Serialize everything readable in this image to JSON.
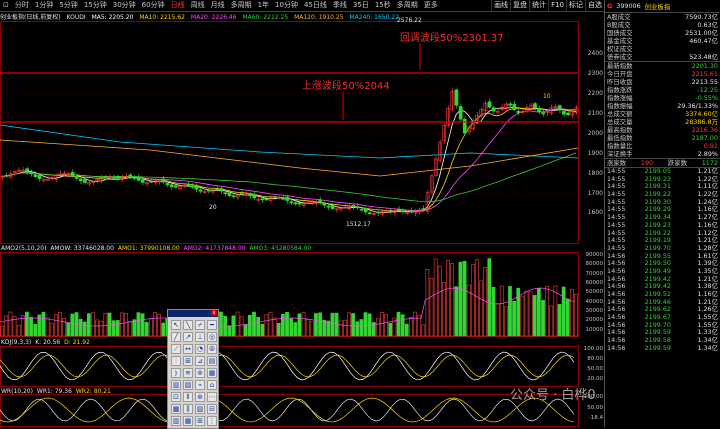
{
  "toolbar": {
    "app_icon": "pin-icon",
    "periods": [
      "分时",
      "1分钟",
      "5分钟",
      "15分钟",
      "30分钟",
      "60分钟",
      "日线",
      "周线",
      "月线",
      "多周期",
      "1年",
      "10分钟",
      "45日线",
      "季线",
      "35日",
      "15秒",
      "多周期",
      "更多"
    ],
    "active_period": "日线",
    "tools": [
      "画线",
      "复盘",
      "统计",
      "F10",
      "标记",
      "自选"
    ]
  },
  "info_line": {
    "title": "创业板指(日线,前复权)",
    "indicator": "KOUDI",
    "ma5": "MA5: 2205.20",
    "ma10": "MA10: 2215.62",
    "ma20": "MA20: 2226.46",
    "ma60": "MA60: 2212.25",
    "ma120": "MA120: 1910.25",
    "ma240": "MA240: 1650.22"
  },
  "price_axis": [
    "2400",
    "2300",
    "2200",
    "2100",
    "2000",
    "1900",
    "1800",
    "1700",
    "1600"
  ],
  "annotations": {
    "high_label": "2576.22",
    "low_label": "1512.17",
    "low_label_left": "20",
    "upper_text": "回调波段50%2301.37",
    "lower_text": "上涨波段50%2044",
    "cursor_marker": "10"
  },
  "colors": {
    "up": "#ff3b3b",
    "down": "#33d633",
    "accent": "#ffd400",
    "line_red": "#e00000"
  },
  "volume": {
    "label": "AMO2(5,10,20)",
    "amow": "AMOW: 33746028.00",
    "amo1": "AMO1: 37990108.00",
    "amo2": "AMO2: 41737848.00",
    "amo3": "AMO3: 45280584.00",
    "axis": [
      "90000",
      "80000",
      "70000",
      "60000",
      "50000",
      "40000",
      "30000",
      "20000",
      "10000"
    ]
  },
  "kdj": {
    "label": "KDJ(9,3,3)",
    "k": "K: 20.56",
    "d": "D: 21.92",
    "axis": [
      "100.00",
      "80.00",
      "50.00",
      "20.00"
    ]
  },
  "wr": {
    "label": "WR(10,20)",
    "wr1": "WR1: 79.36",
    "wr2": "WR2: 80.21",
    "axis": [
      "100.00",
      "50.00",
      "-18.4"
    ]
  },
  "right_panel": {
    "badge": "G",
    "code": "399006",
    "name": "创业板指",
    "stats": [
      {
        "k": "A股成交",
        "v": "7590.73亿",
        "c": "wh"
      },
      {
        "k": "B股成交",
        "v": "0.63亿",
        "c": "wh"
      },
      {
        "k": "国债成交",
        "v": "2531.00亿",
        "c": "wh"
      },
      {
        "k": "基金成交",
        "v": "460.47亿",
        "c": "wh"
      },
      {
        "k": "权证成交",
        "v": "",
        "c": "wh"
      },
      {
        "k": "债券成交",
        "v": "523.48亿",
        "c": "wh"
      }
    ],
    "quote": [
      {
        "k": "最新指数",
        "v": "2201.30",
        "c": "dn"
      },
      {
        "k": "今日开盘",
        "v": "2215.61",
        "c": "up"
      },
      {
        "k": "昨日收盘",
        "v": "2213.55",
        "c": "wh"
      },
      {
        "k": "指数涨跌",
        "v": "-12.25",
        "c": "dn"
      },
      {
        "k": "指数涨幅",
        "v": "-0.55%",
        "c": "dn"
      },
      {
        "k": "指数振幅",
        "v": "29.36/1.33%",
        "c": "wh"
      },
      {
        "k": "总成交额",
        "v": "3374.60亿",
        "c": "yl"
      },
      {
        "k": "总成交量",
        "v": "28386.8万",
        "c": "yl"
      },
      {
        "k": "最高指数",
        "v": "2216.36",
        "c": "up"
      },
      {
        "k": "最低指数",
        "v": "2187.00",
        "c": "dn"
      },
      {
        "k": "指数量比",
        "v": "0.91",
        "c": "up"
      },
      {
        "k": "深证换手",
        "v": "2.89%",
        "c": "wh"
      }
    ],
    "updown": {
      "up_label": "涨家数",
      "up": "190",
      "down_label": "跌家数",
      "down": "1172"
    },
    "trades": [
      [
        "14:55",
        "2199.05",
        "1.21亿"
      ],
      [
        "14:55",
        "2199.23",
        "1.22亿"
      ],
      [
        "14:55",
        "2199.31",
        "1.11亿"
      ],
      [
        "14:55",
        "2199.22",
        "1.22亿"
      ],
      [
        "14:55",
        "2199.30",
        "1.24亿"
      ],
      [
        "14:55",
        "2199.29",
        "1.16亿"
      ],
      [
        "14:55",
        "2199.34",
        "1.27亿"
      ],
      [
        "14:55",
        "2199.23",
        "1.16亿"
      ],
      [
        "14:55",
        "2199.22",
        "1.12亿"
      ],
      [
        "14:55",
        "2199.19",
        "1.21亿"
      ],
      [
        "14:55",
        "2199.70",
        "1.28亿"
      ],
      [
        "14:56",
        "2199.55",
        "1.61亿"
      ],
      [
        "14:56",
        "2199.50",
        "1.39亿"
      ],
      [
        "14:56",
        "2199.49",
        "1.35亿"
      ],
      [
        "14:56",
        "2199.42",
        "1.21亿"
      ],
      [
        "14:56",
        "2199.42",
        "1.38亿"
      ],
      [
        "14:56",
        "2199.52",
        "1.16亿"
      ],
      [
        "14:56",
        "2199.46",
        "1.21亿"
      ],
      [
        "14:56",
        "2199.62",
        "1.26亿"
      ],
      [
        "14:56",
        "2199.67",
        "1.55亿"
      ],
      [
        "14:56",
        "2199.70",
        "1.55亿"
      ],
      [
        "14:56",
        "2199.59",
        "1.33亿"
      ],
      [
        "14:56",
        "2199.58",
        "1.34亿"
      ],
      [
        "14:56",
        "2199.59",
        "1.34亿"
      ]
    ]
  },
  "toolbox": {
    "tools": [
      "↖",
      "╲",
      "⌿",
      "━",
      "╱",
      "↗",
      "⊥",
      "◎",
      "⟋",
      "↔",
      "◔",
      "⦾",
      "⫶",
      "⊞",
      "⊿",
      "▤",
      "⦆",
      "≋",
      "⊚",
      "▦",
      "▥",
      "▧",
      "⌁",
      "⌂",
      "⊡",
      "⫴",
      "⊛",
      "⋯",
      "▩",
      "⫼",
      "▨",
      "⊟",
      "▥",
      "▦",
      "⊞",
      "⋮"
    ]
  },
  "watermark": "公众号 · 白桦0"
}
